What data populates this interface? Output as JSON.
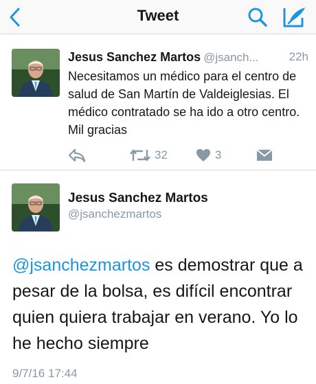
{
  "nav": {
    "title": "Tweet",
    "back_icon": "chevron-left-icon",
    "search_icon": "search-icon",
    "compose_icon": "compose-icon"
  },
  "tweet1": {
    "name": "Jesus Sanchez Martos",
    "handle": "@jsanch...",
    "time": "22h",
    "text": "Necesitamos un médico para el centro de salud de San Martín de Valdeiglesias. El médico contratado se ha ido a otro centro. Mil gracias",
    "retweet_count": "32",
    "like_count": "3"
  },
  "tweet2": {
    "name": "Jesus Sanchez Martos",
    "handle": "@jsanchezmartos",
    "mention": "@jsanchezmartos",
    "text": " es demostrar que a pesar de la bolsa, es difícil encontrar quien quiera trabajar en verano. Yo lo he hecho siempre",
    "date": "9/7/16 17:44"
  },
  "colors": {
    "accent": "#1b95e0",
    "muted": "#8899a6",
    "text": "#14171a"
  }
}
